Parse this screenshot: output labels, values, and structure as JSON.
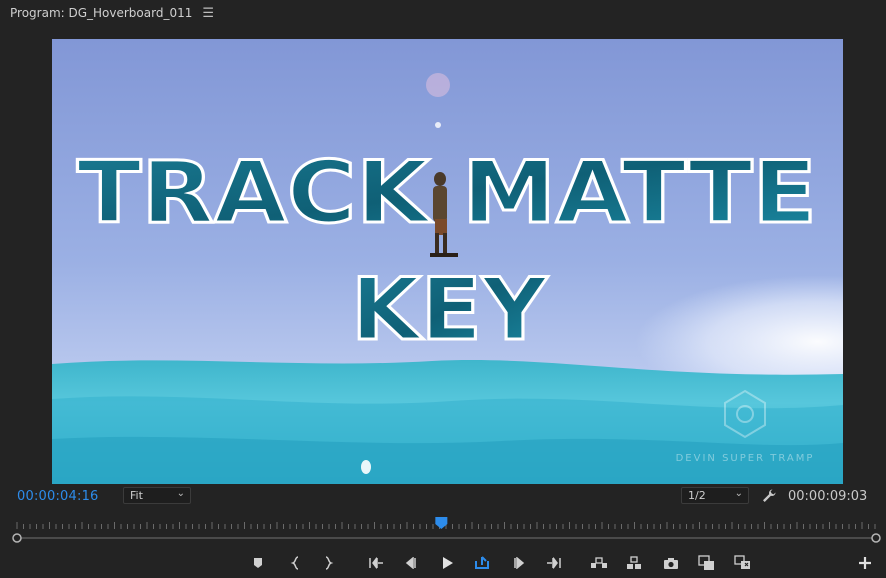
{
  "panel": {
    "title": "Program: DG_Hoverboard_011",
    "menu_icon": "hamburger-menu-icon"
  },
  "video": {
    "title_line1": "TRACK MATTE",
    "title_line2": "KEY",
    "watermark": "DEVIN SUPER TRAMP"
  },
  "info_bar": {
    "current_timecode": "00:00:04:16",
    "zoom_level": "Fit",
    "playback_resolution": "1/2",
    "duration_timecode": "00:00:09:03"
  },
  "playhead": {
    "position_fraction": 0.494
  },
  "transport": {
    "buttons": [
      {
        "name": "add-marker-icon"
      },
      {
        "name": "mark-in-icon"
      },
      {
        "name": "mark-out-icon"
      },
      {
        "name": "go-to-in-icon"
      },
      {
        "name": "step-back-icon"
      },
      {
        "name": "play-icon"
      },
      {
        "name": "loop-playback-icon"
      },
      {
        "name": "step-forward-icon"
      },
      {
        "name": "go-to-out-icon"
      },
      {
        "name": "lift-icon"
      },
      {
        "name": "extract-icon"
      },
      {
        "name": "export-frame-icon"
      },
      {
        "name": "compare-view-icon"
      },
      {
        "name": "proxy-toggle-icon"
      },
      {
        "name": "add-button-icon"
      }
    ]
  },
  "colors": {
    "accent_blue": "#2d8ceb",
    "panel_bg": "#232323",
    "title_fill": "#0f6e86"
  }
}
